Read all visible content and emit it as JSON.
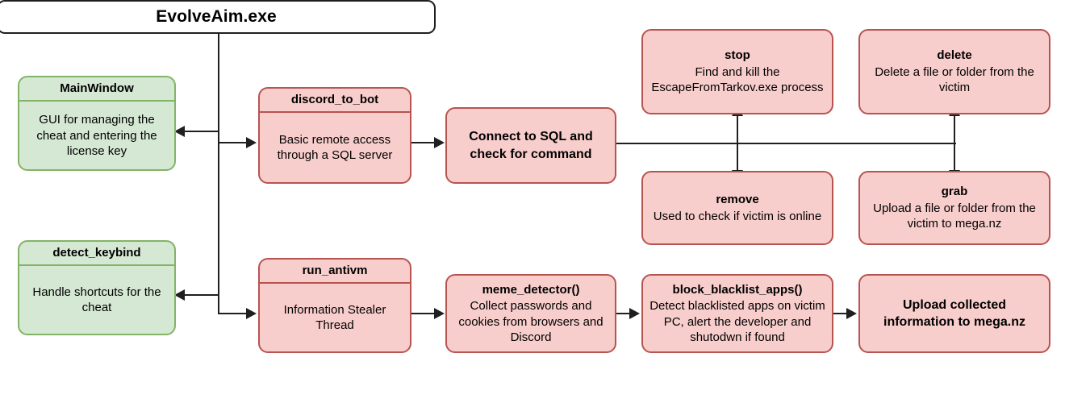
{
  "diagram": {
    "type": "flowchart",
    "root": {
      "label": "EvolveAim.exe"
    },
    "nodes": [
      {
        "id": "mainwindow",
        "style": "green",
        "header": "MainWindow",
        "body": "GUI for managing the cheat and entering the license key"
      },
      {
        "id": "detect_keybind",
        "style": "green",
        "header": "detect_keybind",
        "body": "Handle shortcuts for the cheat"
      },
      {
        "id": "discord_to_bot",
        "style": "pink",
        "header": "discord_to_bot",
        "body": "Basic remote access through a SQL server"
      },
      {
        "id": "run_antivm",
        "style": "pink",
        "header": "run_antivm",
        "body": "Information Stealer Thread"
      },
      {
        "id": "connect_sql",
        "style": "pink",
        "bold_body": "Connect to SQL and check for command"
      },
      {
        "id": "stop",
        "style": "pink",
        "name": "stop",
        "desc": "Find and kill the EscapeFromTarkov.exe process"
      },
      {
        "id": "delete",
        "style": "pink",
        "name": "delete",
        "desc": "Delete a file or folder from the victim"
      },
      {
        "id": "remove",
        "style": "pink",
        "name": "remove",
        "desc": "Used to check if victim is online"
      },
      {
        "id": "grab",
        "style": "pink",
        "name": "grab",
        "desc": "Upload a file or folder from the victim to mega.nz"
      },
      {
        "id": "meme_detector",
        "style": "pink",
        "name": "meme_detector()",
        "desc": "Collect passwords and cookies from browsers and Discord"
      },
      {
        "id": "block_blacklist_apps",
        "style": "pink",
        "name": "block_blacklist_apps()",
        "desc": "Detect blacklisted apps on victim PC, alert the developer and shutodwn if found"
      },
      {
        "id": "upload_mega",
        "style": "pink",
        "bold_body": "Upload collected information to mega.nz"
      }
    ],
    "colors": {
      "pink_fill": "#f8cecc",
      "pink_stroke": "#b85450",
      "green_fill": "#d5e8d4",
      "green_stroke": "#82b366",
      "edge_stroke": "#1f1f1f",
      "root_fill": "#ffffff",
      "root_stroke": "#1f1f1f",
      "background": "#ffffff"
    }
  }
}
